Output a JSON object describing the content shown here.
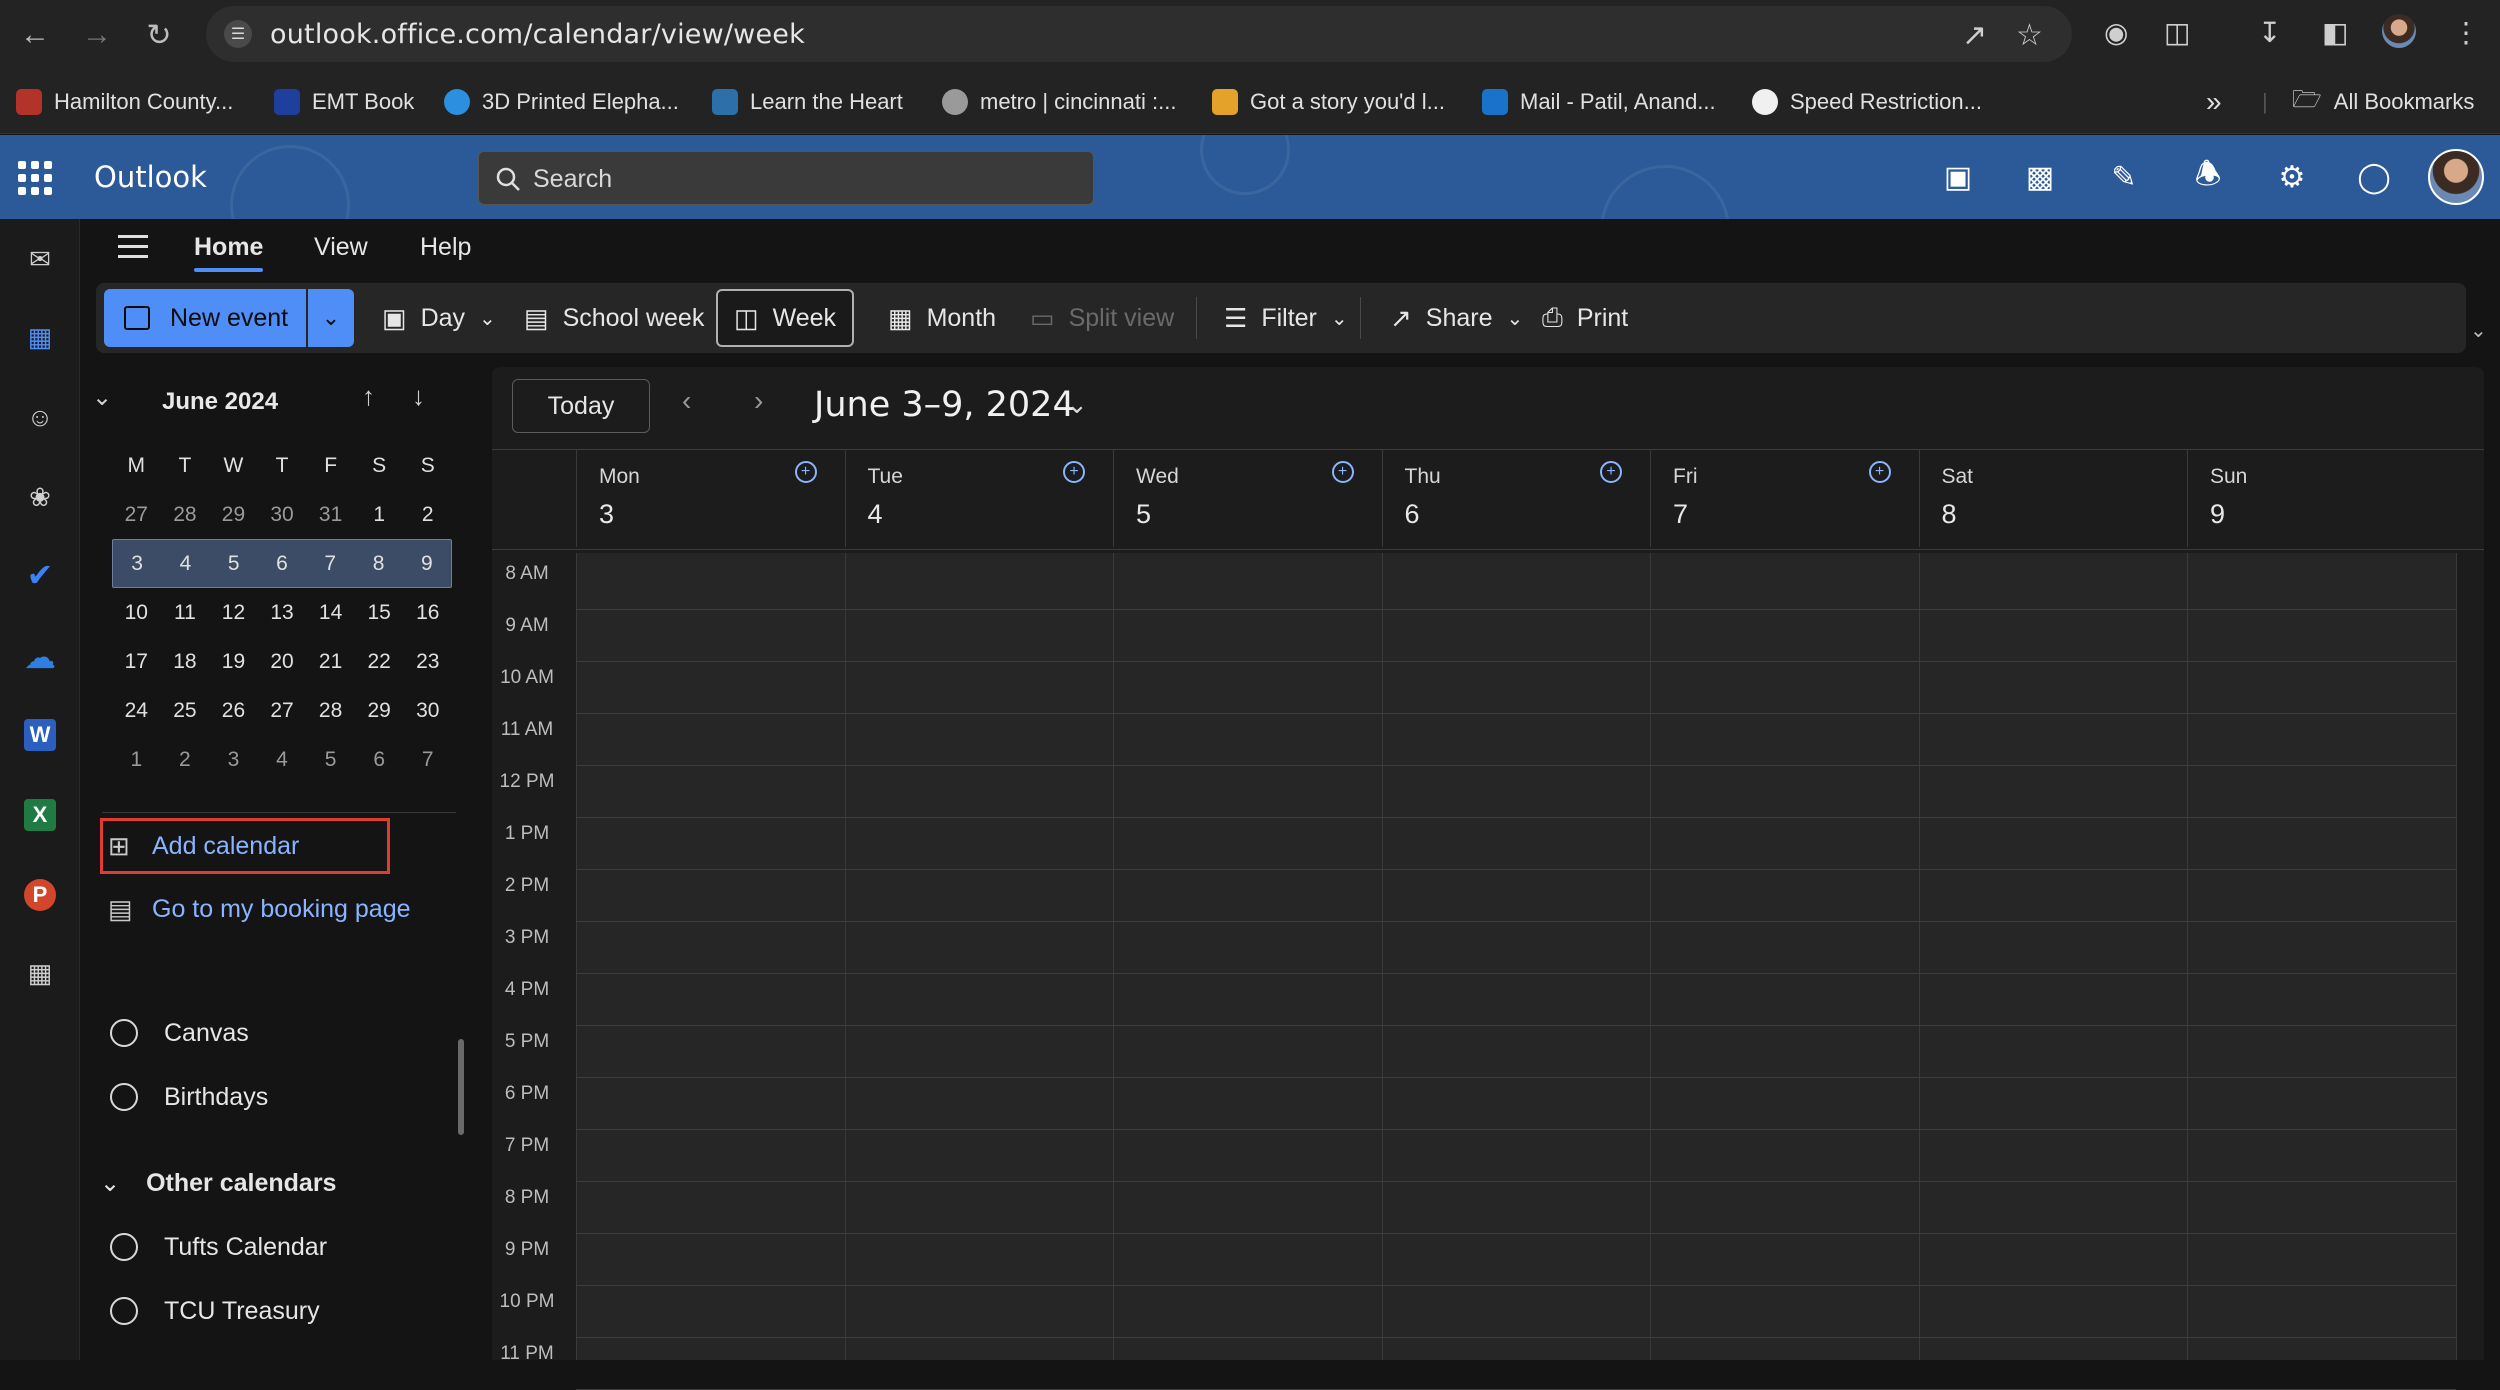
{
  "browser": {
    "url": "outlook.office.com/calendar/view/week",
    "bookmarks": [
      {
        "label": "Hamilton County...",
        "icon": "hamilton-favicon-icon",
        "color": "#b3322a"
      },
      {
        "label": "EMT Book",
        "icon": "emt-favicon-icon",
        "color": "#1f3f9e"
      },
      {
        "label": "3D Printed Elepha...",
        "icon": "3d-favicon-icon",
        "color": "#2c8fe0"
      },
      {
        "label": "Learn the Heart",
        "icon": "heart-favicon-icon",
        "color": "#2d6fa8"
      },
      {
        "label": "metro | cincinnati :...",
        "icon": "globe-icon",
        "color": "#9a9a9a"
      },
      {
        "label": "Got a story you'd l...",
        "icon": "story-favicon-icon",
        "color": "#e4a22b"
      },
      {
        "label": "Mail - Patil, Anand...",
        "icon": "outlook-favicon-icon",
        "color": "#1a73c8"
      },
      {
        "label": "Speed Restriction...",
        "icon": "speed-favicon-icon",
        "color": "#f0f0f0"
      }
    ],
    "all_bookmarks": "All Bookmarks"
  },
  "outlook": {
    "brand": "Outlook",
    "search_placeholder": "Search",
    "tabs": [
      "Home",
      "View",
      "Help"
    ],
    "active_tab": "Home"
  },
  "toolbar": {
    "new_event": "New event",
    "day": "Day",
    "school_week": "School week",
    "week": "Week",
    "month": "Month",
    "split_view": "Split view",
    "filter": "Filter",
    "share": "Share",
    "print": "Print"
  },
  "mini_calendar": {
    "month_label": "June 2024",
    "weekdays": [
      "M",
      "T",
      "W",
      "T",
      "F",
      "S",
      "S"
    ],
    "weeks": [
      [
        "27",
        "28",
        "29",
        "30",
        "31",
        "1",
        "2"
      ],
      [
        "3",
        "4",
        "5",
        "6",
        "7",
        "8",
        "9"
      ],
      [
        "10",
        "11",
        "12",
        "13",
        "14",
        "15",
        "16"
      ],
      [
        "17",
        "18",
        "19",
        "20",
        "21",
        "22",
        "23"
      ],
      [
        "24",
        "25",
        "26",
        "27",
        "28",
        "29",
        "30"
      ],
      [
        "1",
        "2",
        "3",
        "4",
        "5",
        "6",
        "7"
      ]
    ],
    "selected_week_index": 1
  },
  "sidebar": {
    "add_calendar": "Add calendar",
    "booking_page": "Go to my booking page",
    "my_calendars": [
      "Canvas",
      "Birthdays"
    ],
    "other_header": "Other calendars",
    "other_calendars": [
      "Tufts Calendar",
      "TCU Treasury"
    ]
  },
  "calendar": {
    "today": "Today",
    "range": "June 3–9, 2024",
    "days": [
      {
        "name": "Mon",
        "date": "3"
      },
      {
        "name": "Tue",
        "date": "4"
      },
      {
        "name": "Wed",
        "date": "5"
      },
      {
        "name": "Thu",
        "date": "6"
      },
      {
        "name": "Fri",
        "date": "7"
      },
      {
        "name": "Sat",
        "date": "8"
      },
      {
        "name": "Sun",
        "date": "9"
      }
    ],
    "hours": [
      "8 AM",
      "9 AM",
      "10 AM",
      "11 AM",
      "12 PM",
      "1 PM",
      "2 PM",
      "3 PM",
      "4 PM",
      "5 PM",
      "6 PM",
      "7 PM",
      "8 PM",
      "9 PM",
      "10 PM",
      "11 PM"
    ]
  }
}
